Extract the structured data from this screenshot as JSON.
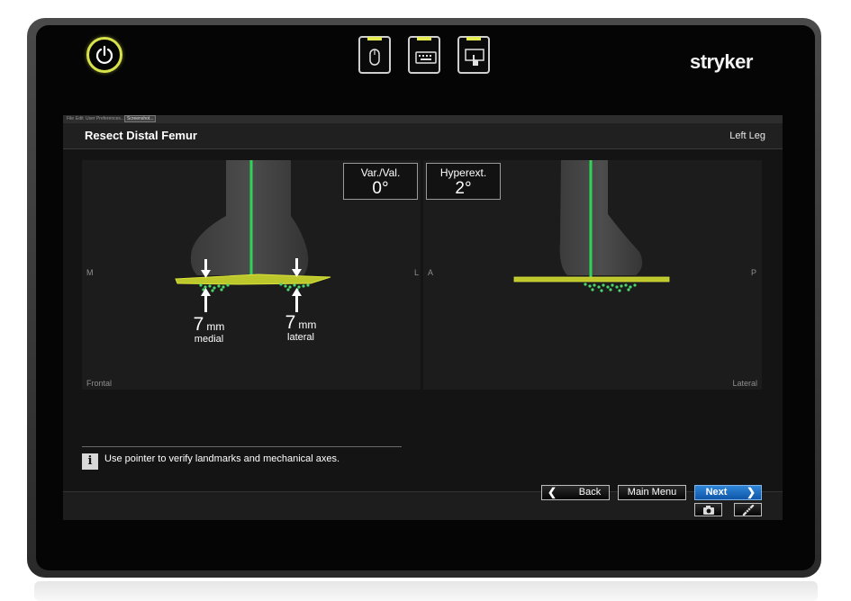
{
  "device": {
    "brand": "stryker",
    "hardware_buttons": [
      {
        "name": "mouse-mode-button",
        "icon": "mouse-icon"
      },
      {
        "name": "keyboard-mode-button",
        "icon": "keyboard-icon"
      },
      {
        "name": "touch-mode-button",
        "icon": "touch-icon"
      }
    ],
    "power_icon": "power-icon",
    "accent_color": "#e7ec52"
  },
  "app": {
    "menu": [
      "File",
      "Edit",
      "User Preferences...",
      "Screenshot..."
    ],
    "title": "Resect Distal Femur",
    "leg": "Left Leg"
  },
  "frontal_view": {
    "side_left": "M",
    "side_right": "L",
    "view_name": "Frontal",
    "medial": {
      "value": "7",
      "unit": "mm",
      "label": "medial"
    },
    "lateral": {
      "value": "7",
      "unit": "mm",
      "label": "lateral"
    }
  },
  "lateral_view": {
    "side_left": "A",
    "side_right": "P",
    "view_name": "Lateral"
  },
  "readouts": {
    "varus_valgus": {
      "label": "Var./Val.",
      "value": "0°"
    },
    "hyperext": {
      "label": "Hyperext.",
      "value": "2°"
    }
  },
  "info": {
    "icon": "info-icon",
    "text": "Use pointer to verify landmarks and mechanical axes."
  },
  "navigation": {
    "back": "Back",
    "main_menu": "Main Menu",
    "next": "Next",
    "next_color": "#1f6fc4"
  },
  "tools": {
    "camera_icon": "camera-icon",
    "pointer_icon": "pointer-tool-icon"
  },
  "colors": {
    "axis_green": "#2fd35a",
    "resection_plane": "#c9d430",
    "landmark_points": "#4bd66b"
  }
}
